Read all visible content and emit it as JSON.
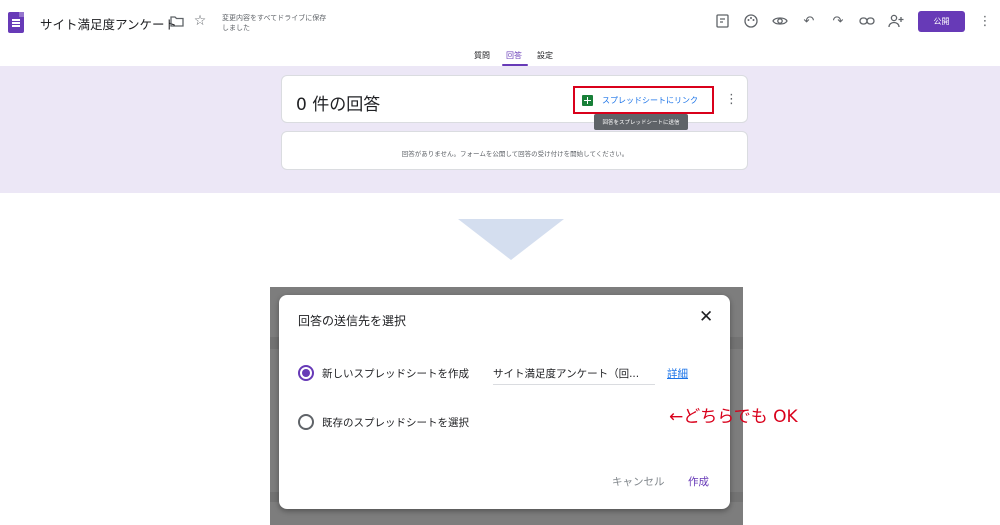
{
  "header": {
    "title": "サイト満足度アンケート",
    "save_status": "変更内容をすべてドライブに保存しました",
    "publish_label": "公開"
  },
  "tabs": [
    {
      "label": "質問",
      "active": false
    },
    {
      "label": "回答",
      "active": true
    },
    {
      "label": "設定",
      "active": false
    }
  ],
  "responses": {
    "count_text": "0 件の回答",
    "link_sheets_label": "スプレッドシートにリンク",
    "tooltip": "回答をスプレッドシートに送信",
    "empty_message": "回答がありません。フォームを公開して回答の受け付けを開始してください。"
  },
  "dialog": {
    "title": "回答の送信先を選択",
    "option_new_label": "新しいスプレッドシートを作成",
    "option_new_selected": true,
    "new_sheet_name": "サイト満足度アンケート（回...",
    "details_link": "詳細",
    "option_existing_label": "既存のスプレッドシートを選択",
    "option_existing_selected": false,
    "cancel_label": "キャンセル",
    "create_label": "作成"
  },
  "annotation": {
    "note": "←どちらでも OK",
    "color": "#d9001b"
  },
  "colors": {
    "accent": "#673ab7",
    "band": "#ece7f6",
    "link": "#1a73e8",
    "sheets_green": "#188038",
    "arrow": "#d4deef"
  }
}
